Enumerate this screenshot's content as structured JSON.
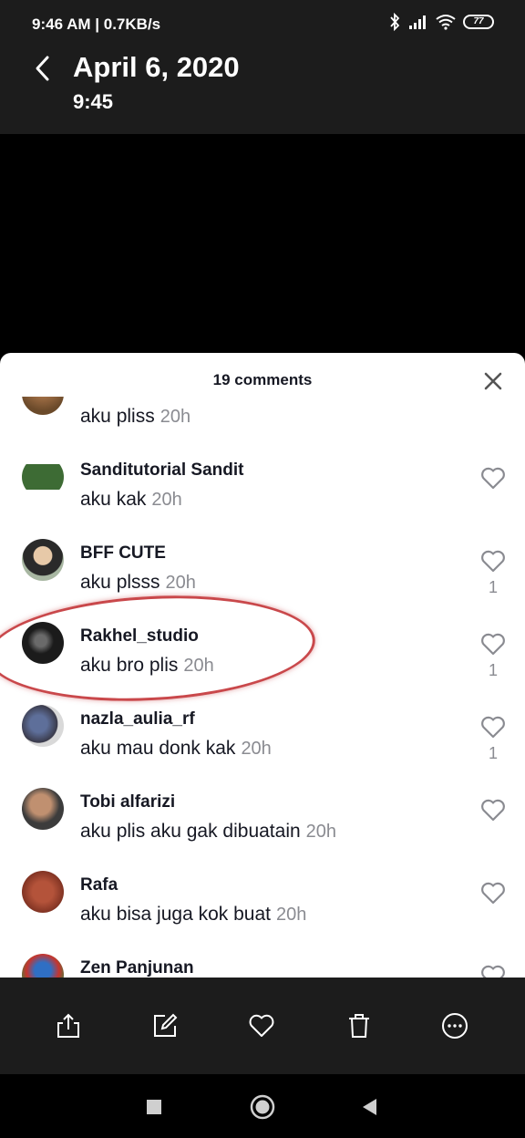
{
  "status_bar": {
    "time": "9:46 AM | 0.7KB/s",
    "battery": "77",
    "icons": [
      "bluetooth-icon",
      "signal-icon",
      "wifi-icon",
      "battery-icon"
    ]
  },
  "header": {
    "title": "April 6, 2020",
    "subtitle": "9:45"
  },
  "sheet": {
    "title": "19 comments",
    "comments": [
      {
        "user": "",
        "text": "aku pliss",
        "time": "20h",
        "likes": ""
      },
      {
        "user": "Sanditutorial Sandit",
        "text": "aku kak",
        "time": "20h",
        "likes": ""
      },
      {
        "user": "BFF CUTE",
        "text": "aku plsss",
        "time": "20h",
        "likes": "1"
      },
      {
        "user": "Rakhel_studio",
        "text": "aku bro plis",
        "time": "20h",
        "likes": "1"
      },
      {
        "user": "nazla_aulia_rf",
        "text": "aku mau donk kak",
        "time": "20h",
        "likes": "1"
      },
      {
        "user": "Tobi alfarizi",
        "text": "aku plis aku gak dibuatain",
        "time": "20h",
        "likes": ""
      },
      {
        "user": "Rafa",
        "text": "aku bisa juga kok buat",
        "time": "20h",
        "likes": ""
      },
      {
        "user": "Zen Panjunan",
        "text": "",
        "time": "",
        "likes": ""
      }
    ]
  },
  "actions": [
    "share-icon",
    "edit-icon",
    "like-icon",
    "delete-icon",
    "more-icon"
  ],
  "nav": [
    "recents-icon",
    "home-icon",
    "back-icon"
  ],
  "colors": {
    "highlight": "#c9484b",
    "muted": "#8a8b91",
    "bar": "#1c1c1c"
  }
}
